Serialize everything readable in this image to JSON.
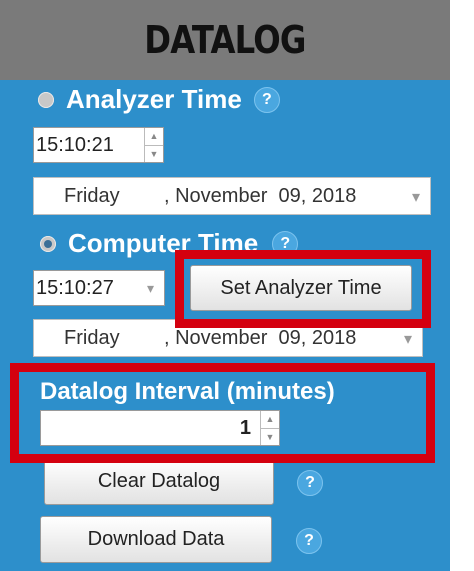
{
  "title": "DATALOG",
  "analyzer": {
    "label": "Analyzer Time",
    "time": "15:10:21",
    "date_day": "Friday",
    "date_rest": ", November  09, 2018"
  },
  "computer": {
    "label": "Computer Time",
    "time": "15:10:27",
    "date_day": "Friday",
    "date_rest": ", November  09, 2018"
  },
  "buttons": {
    "set_analyzer_time": "Set Analyzer Time",
    "clear_datalog": "Clear Datalog",
    "download_data": "Download Data"
  },
  "interval": {
    "label": "Datalog Interval (minutes)",
    "value": "1"
  },
  "help_glyph": "?",
  "highlight_color": "#d4000f"
}
